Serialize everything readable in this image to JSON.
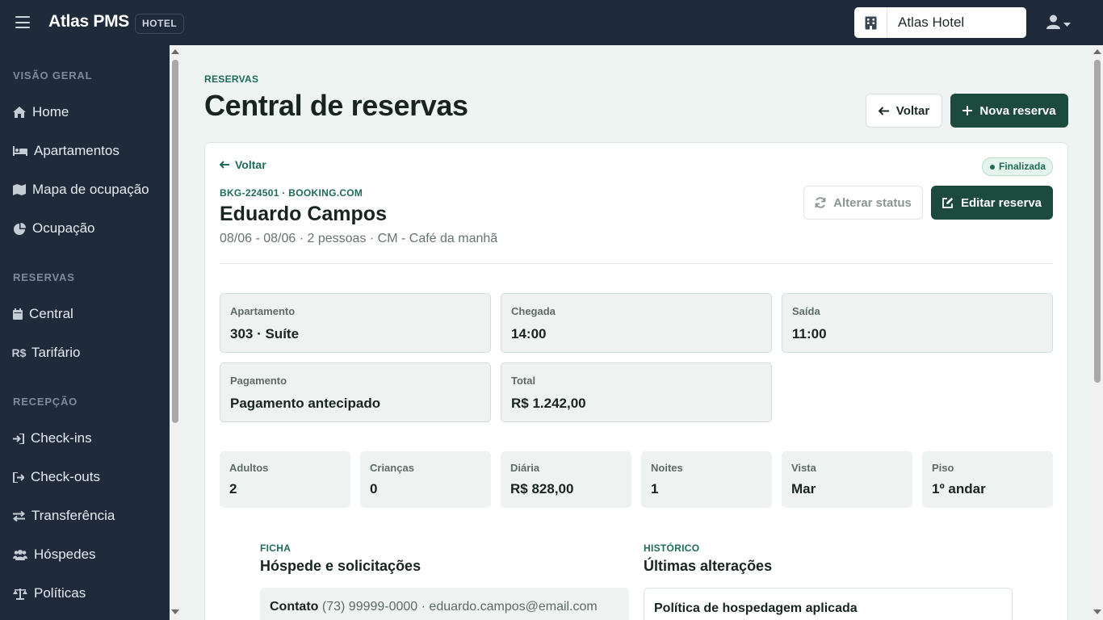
{
  "topbar": {
    "brand": "Atlas PMS",
    "brand_badge": "HOTEL",
    "hotel_selector": "Atlas Hotel"
  },
  "sidebar": {
    "groups": [
      {
        "label": "VISÃO GERAL"
      },
      {
        "label": "RESERVAS"
      },
      {
        "label": "RECEPÇÃO"
      }
    ],
    "items": [
      {
        "label": "Home",
        "icon": "home-icon"
      },
      {
        "label": "Apartamentos",
        "icon": "bed-icon"
      },
      {
        "label": "Mapa de ocupação",
        "icon": "map-icon"
      },
      {
        "label": "Ocupação",
        "icon": "pie-chart-icon"
      },
      {
        "label": "Central",
        "icon": "calendar-icon"
      },
      {
        "label": "Tarifário",
        "icon": "currency-icon"
      },
      {
        "label": "Check-ins",
        "icon": "sign-in-icon"
      },
      {
        "label": "Check-outs",
        "icon": "sign-out-icon"
      },
      {
        "label": "Transferência",
        "icon": "transfer-icon"
      },
      {
        "label": "Hóspedes",
        "icon": "users-icon"
      },
      {
        "label": "Políticas",
        "icon": "scale-icon"
      }
    ]
  },
  "page": {
    "eyebrow": "RESERVAS",
    "title": "Central de reservas",
    "back_button": "Voltar",
    "new_button": "Nova reserva"
  },
  "booking": {
    "back_link": "Voltar",
    "status": "Finalizada",
    "code": "BKG-224501 · BOOKING.COM",
    "guest_name": "Eduardo Campos",
    "summary": "08/06 - 08/06 · 2 pessoas · CM - Café da manhã",
    "change_status_button": "Alterar status",
    "edit_button": "Editar reserva",
    "info": [
      {
        "label": "Apartamento",
        "value": "303 · Suíte"
      },
      {
        "label": "Chegada",
        "value": "14:00"
      },
      {
        "label": "Saída",
        "value": "11:00"
      },
      {
        "label": "Pagamento",
        "value": "Pagamento antecipado"
      },
      {
        "label": "Total",
        "value": "R$ 1.242,00"
      }
    ],
    "stats": [
      {
        "label": "Adultos",
        "value": "2"
      },
      {
        "label": "Crianças",
        "value": "0"
      },
      {
        "label": "Diária",
        "value": "R$ 828,00"
      },
      {
        "label": "Noites",
        "value": "1"
      },
      {
        "label": "Vista",
        "value": "Mar"
      },
      {
        "label": "Piso",
        "value": "1º andar"
      }
    ]
  },
  "ficha": {
    "eyebrow": "FICHA",
    "title": "Hóspede e solicitações",
    "contact_label": "Contato",
    "contact_value": "(73) 99999-0000 · eduardo.campos@email.com"
  },
  "historico": {
    "eyebrow": "HISTÓRICO",
    "title": "Últimas alterações",
    "first_entry": "Política de hospedagem aplicada"
  },
  "colors": {
    "sidebar_bg": "#1f2a3a",
    "accent": "#1d4a3e",
    "accent_text": "#1e6b58",
    "page_bg": "#eef4f1"
  }
}
